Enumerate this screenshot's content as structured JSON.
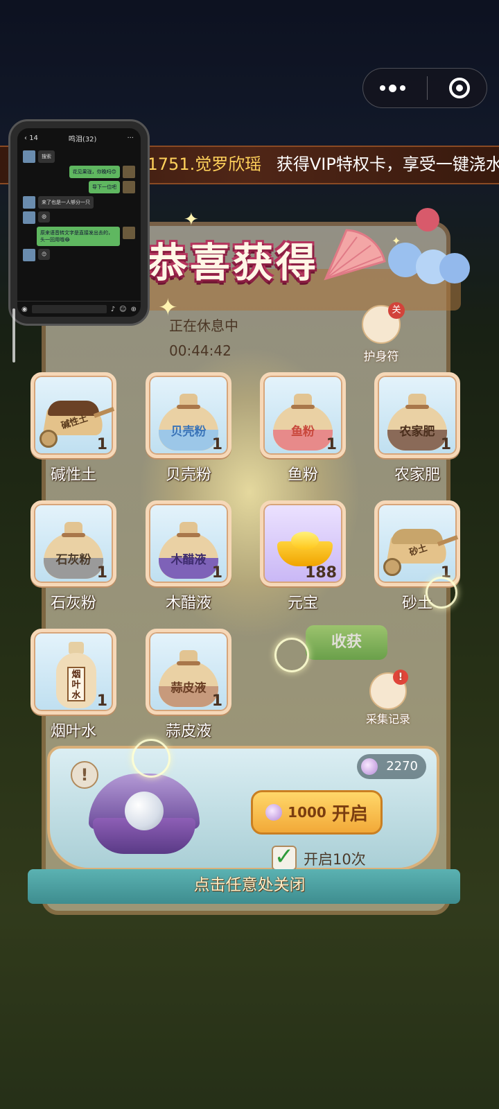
{
  "capsule": {
    "menu_icon": "more-dots-icon",
    "close_icon": "target-circle-icon"
  },
  "marquee": {
    "player": "s1751.觉罗欣瑶",
    "message": "获得VIP特权卡，享受一键浇水."
  },
  "chat_window": {
    "title": "鸣泪(32)",
    "back_count": "14",
    "messages": [
      {
        "side": "left",
        "text": "搜索"
      },
      {
        "side": "right",
        "text": "花见果珑，你晚吗😊"
      },
      {
        "side": "right",
        "text": "导下一位吧"
      },
      {
        "side": "left",
        "text": "来了也是一人够分一只"
      },
      {
        "side": "left",
        "text": "😄"
      },
      {
        "side": "right",
        "text": "原来语音转文字是直接发出去的，头一回用哦😂"
      },
      {
        "side": "left",
        "text": "😊"
      }
    ]
  },
  "title": "恭喜获得",
  "rest": {
    "status": "正在休息中",
    "timer": "00:44:42"
  },
  "charm": {
    "label": "护身符",
    "tag": "关"
  },
  "items": [
    {
      "label": "碱性土",
      "count": "1",
      "tile_text": "碱性土"
    },
    {
      "label": "贝壳粉",
      "count": "1",
      "tile_text": "贝壳粉"
    },
    {
      "label": "鱼粉",
      "count": "1",
      "tile_text": "鱼粉"
    },
    {
      "label": "农家肥",
      "count": "1",
      "tile_text": "农家肥"
    },
    {
      "label": "石灰粉",
      "count": "1",
      "tile_text": "石灰粉"
    },
    {
      "label": "木醋液",
      "count": "1",
      "tile_text": "木醋液"
    },
    {
      "label": "元宝",
      "count": "188",
      "tile_text": ""
    },
    {
      "label": "砂土",
      "count": "1",
      "tile_text": "砂土"
    },
    {
      "label": "烟叶水",
      "count": "1",
      "tile_text": "烟叶水"
    },
    {
      "label": "蒜皮液",
      "count": "1",
      "tile_text": "蒜皮液"
    }
  ],
  "harvest_label": "收获",
  "record_label": "采集记录",
  "record_badge": "!",
  "gems_balance": "2270",
  "open_button": {
    "cost": "1000",
    "label": "开启"
  },
  "open_ten": {
    "checked": true,
    "label": "开启10次"
  },
  "close_hint": "点击任意处关闭",
  "colors": {
    "title_outline": "#8d1f43",
    "tile_border": "#f6d8b8",
    "button_gold": "#f2a938"
  }
}
